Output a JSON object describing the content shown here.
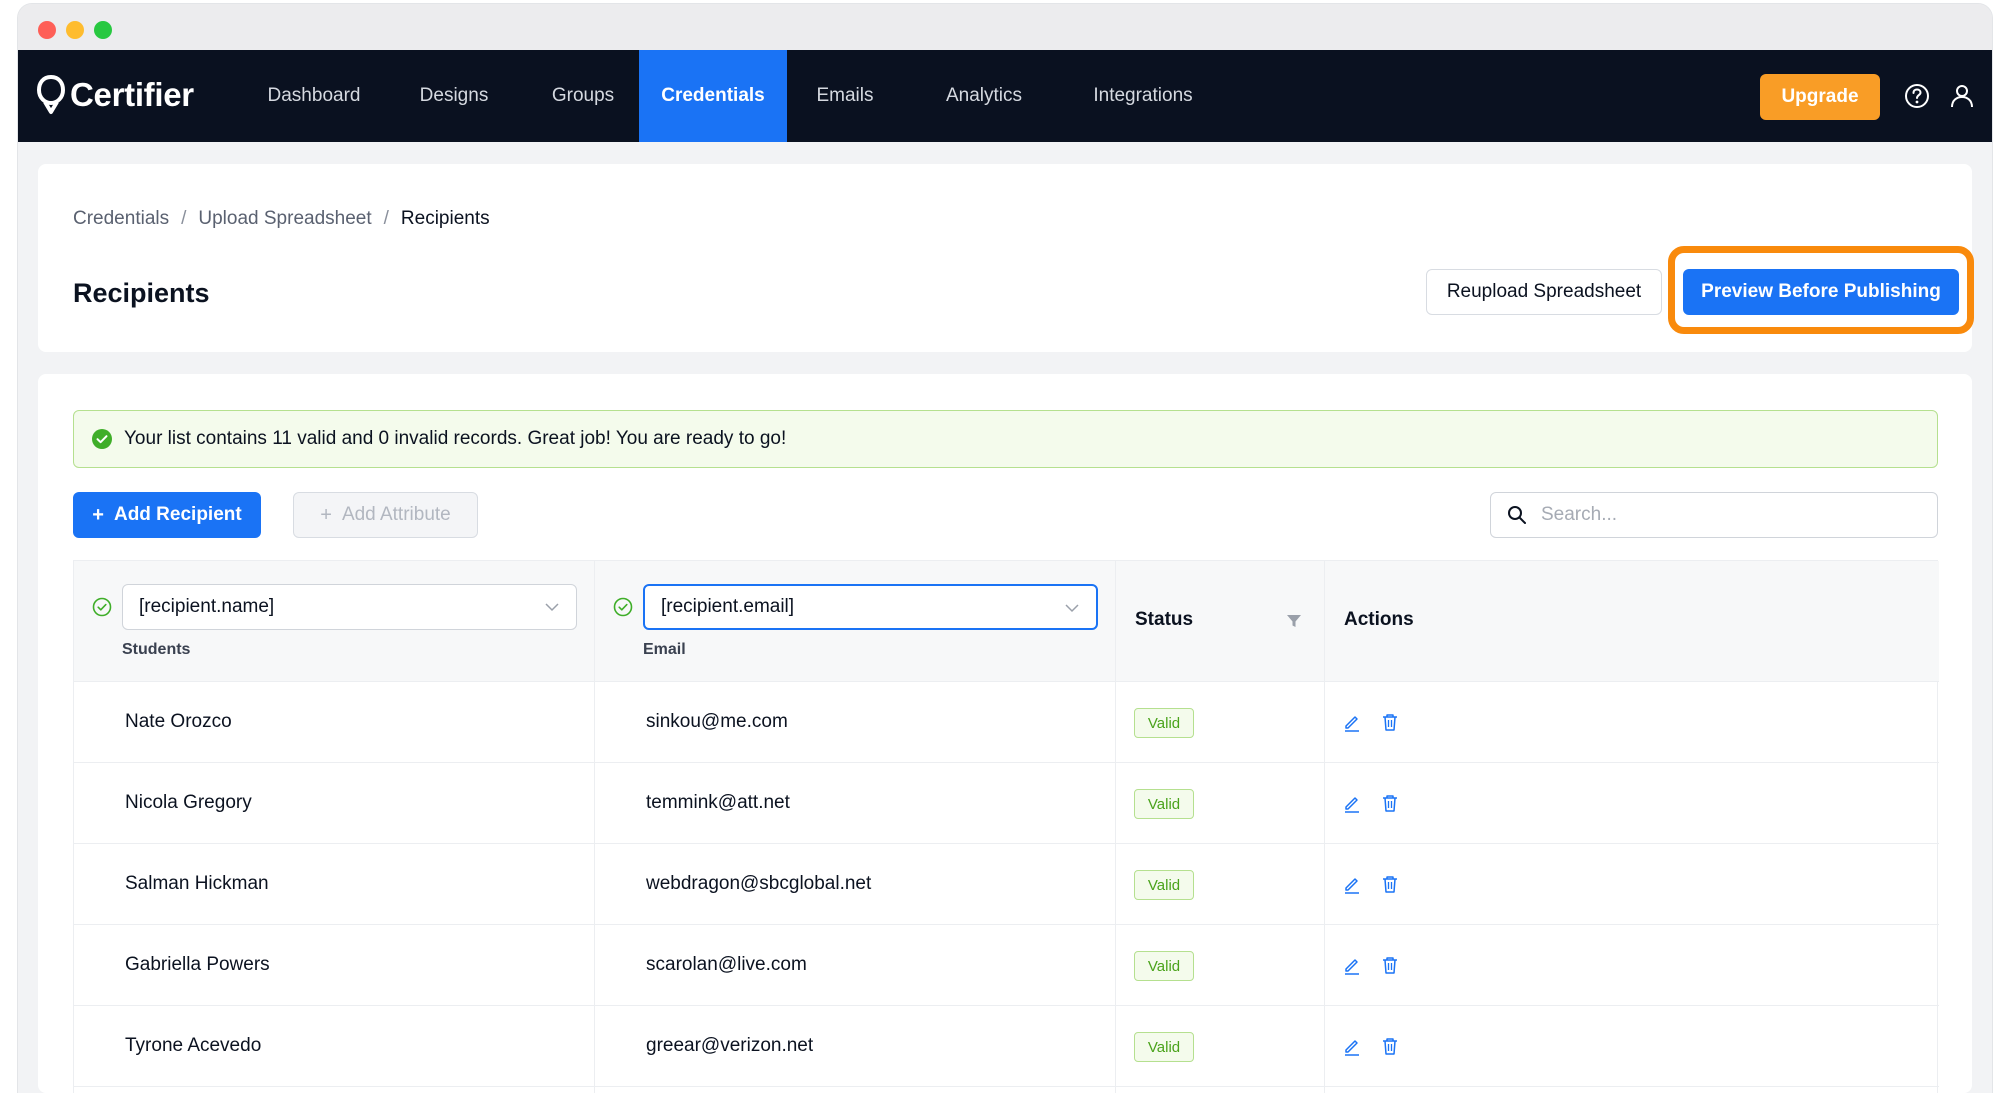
{
  "app": {
    "logo_text": "Certifier",
    "nav": [
      {
        "label": "Dashboard"
      },
      {
        "label": "Designs"
      },
      {
        "label": "Groups"
      },
      {
        "label": "Credentials",
        "active": true
      },
      {
        "label": "Emails"
      },
      {
        "label": "Analytics"
      },
      {
        "label": "Integrations"
      }
    ],
    "upgrade_label": "Upgrade",
    "icons": {
      "help": "help-circle-icon",
      "user": "user-icon"
    },
    "colors": {
      "nav_bg": "#0a1120",
      "accent": "#1a73f5",
      "upgrade": "#f99d26",
      "highlight": "#f98a0c",
      "valid": "#4aa31b"
    }
  },
  "breadcrumb": {
    "items": [
      "Credentials",
      "Upload Spreadsheet",
      "Recipients"
    ],
    "separator": "/"
  },
  "page": {
    "title": "Recipients",
    "reupload_label": "Reupload Spreadsheet",
    "preview_label": "Preview Before Publishing"
  },
  "alert": {
    "message": "Your list contains 11 valid and 0 invalid records. Great job! You are ready to go!"
  },
  "toolbar": {
    "add_recipient_label": "Add Recipient",
    "add_attribute_label": "Add Attribute",
    "plus": "+",
    "search_placeholder": "Search..."
  },
  "table": {
    "columns": [
      {
        "select_value": "[recipient.name]",
        "sublabel": "Students"
      },
      {
        "select_value": "[recipient.email]",
        "sublabel": "Email"
      },
      {
        "label": "Status"
      },
      {
        "label": "Actions"
      }
    ],
    "rows": [
      {
        "name": "Nate Orozco",
        "email": "sinkou@me.com",
        "status": "Valid"
      },
      {
        "name": "Nicola Gregory",
        "email": "temmink@att.net",
        "status": "Valid"
      },
      {
        "name": "Salman Hickman",
        "email": "webdragon@sbcglobal.net",
        "status": "Valid"
      },
      {
        "name": "Gabriella Powers",
        "email": "scarolan@live.com",
        "status": "Valid"
      },
      {
        "name": "Tyrone Acevedo",
        "email": "greear@verizon.net",
        "status": "Valid"
      }
    ]
  }
}
